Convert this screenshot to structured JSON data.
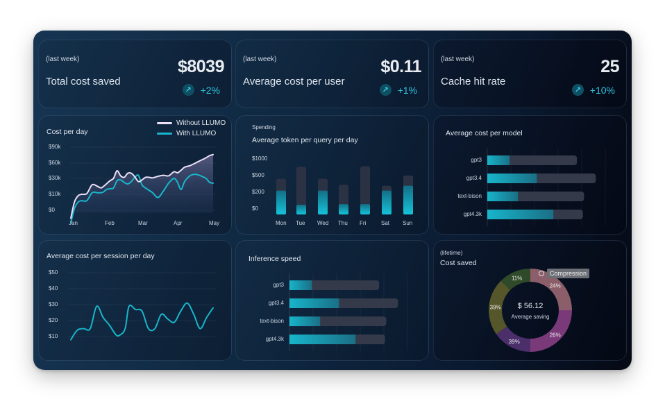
{
  "kpis": [
    {
      "period": "(last week)",
      "label": "Total cost saved",
      "value": "$8039",
      "trend_icon": "arrow-up-right-icon",
      "change": "+2%"
    },
    {
      "period": "(last week)",
      "label": "Average cost per user",
      "value": "$0.11",
      "trend_icon": "arrow-up-right-icon",
      "change": "+1%"
    },
    {
      "period": "(last week)",
      "label": "Cache hit rate",
      "value": "25",
      "trend_icon": "arrow-up-right-icon",
      "change": "+10%"
    }
  ],
  "colors": {
    "accent_cyan": "#19b6cc",
    "line_without": "#ece0f7",
    "track": "#343a4a",
    "trend_text": "#2fc6e0"
  },
  "chart_data": [
    {
      "id": "cost_per_day",
      "type": "line",
      "title": "Cost per day",
      "legend_position": "top-right",
      "x_ticks": [
        "Jan",
        "Feb",
        "Mar",
        "Apr",
        "May"
      ],
      "y_ticks": [
        "$90k",
        "$60k",
        "$30k",
        "$10k",
        "$0"
      ],
      "y_tick_values": [
        90,
        60,
        30,
        10,
        0
      ],
      "x": [
        0,
        0.1,
        0.2,
        0.3,
        0.45,
        0.6,
        0.75,
        0.85,
        0.92,
        1.0,
        1.1,
        1.2,
        1.3,
        1.4,
        1.5,
        1.6,
        1.7,
        1.8,
        1.9,
        2.0,
        2.1,
        2.2,
        2.3,
        2.45,
        2.6,
        2.75,
        2.9,
        3.0,
        3.1,
        3.2,
        3.35,
        3.5,
        3.65,
        3.8,
        3.9,
        4.0
      ],
      "series": [
        {
          "name": "Without LLUMO",
          "color": "#ece0f7",
          "area": true,
          "values": [
            -5,
            5,
            9,
            10,
            11,
            22,
            20,
            18,
            20,
            23,
            27,
            30,
            45,
            35,
            32,
            40,
            40,
            33,
            26,
            28,
            32,
            32,
            31,
            34,
            36,
            35,
            43,
            41,
            46,
            52,
            55,
            60,
            65,
            70,
            74,
            76
          ]
        },
        {
          "name": "With LLUMO",
          "color": "#19b6cc",
          "area": false,
          "values": [
            -8,
            1,
            5,
            6,
            6,
            12,
            12,
            12,
            13,
            16,
            17,
            18,
            27,
            28,
            25,
            23,
            26,
            32,
            36,
            22,
            18,
            15,
            12,
            8,
            14,
            24,
            30,
            25,
            16,
            26,
            35,
            38,
            35,
            30,
            25,
            24
          ]
        }
      ]
    },
    {
      "id": "avg_token_per_query",
      "type": "bar",
      "kicker": "Spending",
      "title": "Average token per query per day",
      "categories": [
        "Mon",
        "Tue",
        "Wed",
        "Thu",
        "Fri",
        "Sat",
        "Sun"
      ],
      "y_ticks": [
        "$1000",
        "$500",
        "$200",
        "$0"
      ],
      "series": [
        {
          "name": "total",
          "color": "#2b3244",
          "values": [
            0.66,
            0.88,
            0.66,
            0.55,
            0.89,
            0.53,
            0.72
          ]
        },
        {
          "name": "value",
          "color": "#19b6cc",
          "values": [
            0.44,
            0.18,
            0.44,
            0.19,
            0.19,
            0.44,
            0.53
          ]
        }
      ],
      "value_units": "fraction of axis height"
    },
    {
      "id": "avg_cost_per_model",
      "type": "bar",
      "orientation": "horizontal",
      "title": "Average cost per model",
      "categories": [
        "gpt3",
        "gpt3.4",
        "text-bison",
        "gpt4.3k"
      ],
      "series": [
        {
          "name": "total",
          "color": "#343a4a",
          "values": [
            0.76,
            0.92,
            0.82,
            0.81
          ]
        },
        {
          "name": "value",
          "color": "#19b6cc",
          "values": [
            0.19,
            0.42,
            0.26,
            0.56
          ]
        }
      ],
      "value_units": "fraction of axis width",
      "grid": true
    },
    {
      "id": "avg_cost_per_session",
      "type": "line",
      "title": "Average cost per session per day",
      "y_ticks": [
        "$50",
        "$40",
        "$30",
        "$20",
        "$10"
      ],
      "y_tick_values": [
        50,
        40,
        30,
        20,
        10
      ],
      "x": [
        0,
        0.05,
        0.1,
        0.15,
        0.2,
        0.25,
        0.3,
        0.35,
        0.38,
        0.42,
        0.45,
        0.5,
        0.55,
        0.6,
        0.65,
        0.7,
        0.75,
        0.8,
        0.85,
        0.9,
        0.95,
        1.0
      ],
      "series": [
        {
          "name": "Cost",
          "color": "#19b6cc",
          "values": [
            8,
            14,
            15,
            15,
            29,
            22,
            17,
            11,
            11,
            15,
            29,
            27,
            26,
            15,
            15,
            24,
            21,
            19,
            26,
            31,
            24,
            15
          ]
        }
      ],
      "series_tail": {
        "x": [
          1.05,
          1.1
        ],
        "values": [
          22,
          28
        ]
      }
    },
    {
      "id": "inference_speed",
      "type": "bar",
      "orientation": "horizontal",
      "title": "Inference speed",
      "categories": [
        "gpt3",
        "gpt3.4",
        "text-bison",
        "gpt4.3k"
      ],
      "series": [
        {
          "name": "total",
          "color": "#343a4a",
          "values": [
            0.76,
            0.92,
            0.82,
            0.81
          ]
        },
        {
          "name": "value",
          "color": "#19b6cc",
          "values": [
            0.19,
            0.42,
            0.26,
            0.56
          ]
        }
      ],
      "value_units": "fraction of axis width",
      "grid": true
    },
    {
      "id": "cost_saved",
      "type": "pie",
      "donut": true,
      "kicker": "(lifetime)",
      "title": "Cost saved",
      "center_value": "$ 56.12",
      "center_label": "Average saving",
      "tooltip": "Compression",
      "slices": [
        {
          "label": "24%",
          "color": "#8b5e69",
          "sweep_deg": 90
        },
        {
          "label": "26%",
          "color": "#7a3a7a",
          "sweep_deg": 90
        },
        {
          "label": "39%",
          "color": "#4a2f6b",
          "sweep_deg": 55
        },
        {
          "label": "39%",
          "color": "#55562a",
          "sweep_deg": 80
        },
        {
          "label": "11%",
          "color": "#2f4a28",
          "sweep_deg": 45
        }
      ]
    }
  ]
}
